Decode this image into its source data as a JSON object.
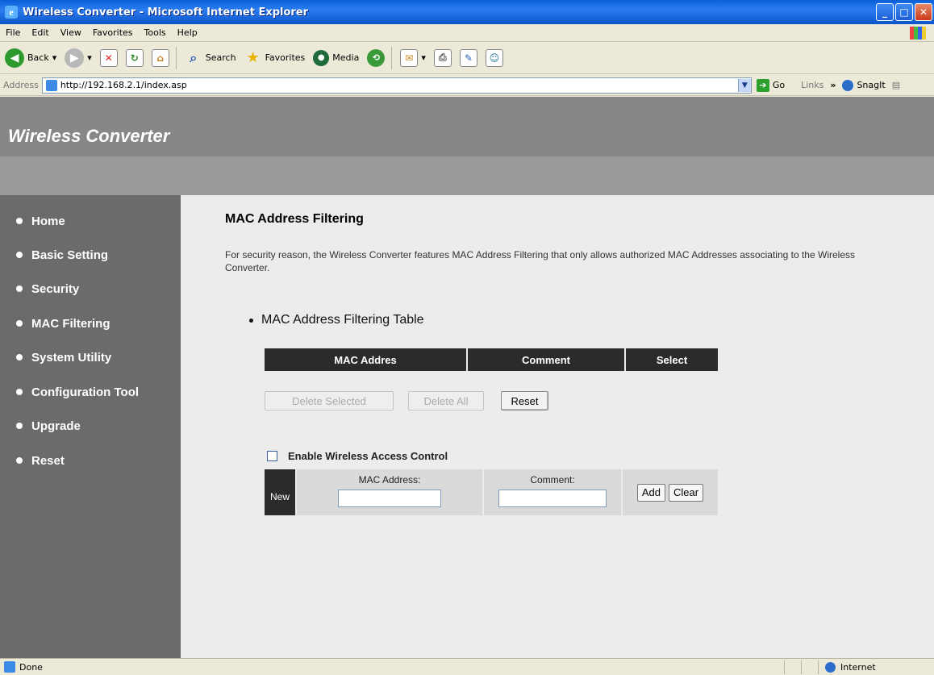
{
  "window": {
    "title": "Wireless Converter - Microsoft Internet Explorer"
  },
  "menu": [
    "File",
    "Edit",
    "View",
    "Favorites",
    "Tools",
    "Help"
  ],
  "toolbar": {
    "back": "Back",
    "search": "Search",
    "favorites": "Favorites",
    "media": "Media"
  },
  "address": {
    "label": "Address",
    "url": "http://192.168.2.1/index.asp",
    "go": "Go",
    "links": "Links",
    "snagit": "SnagIt"
  },
  "header": {
    "brand": "Wireless Converter"
  },
  "sidebar": {
    "items": [
      {
        "label": "Home"
      },
      {
        "label": "Basic Setting"
      },
      {
        "label": "Security"
      },
      {
        "label": "MAC Filtering"
      },
      {
        "label": "System Utility"
      },
      {
        "label": "Configuration Tool"
      },
      {
        "label": "Upgrade"
      },
      {
        "label": "Reset"
      }
    ]
  },
  "main": {
    "title": "MAC Address Filtering",
    "description": "For security reason, the Wireless Converter features MAC Address Filtering that only allows authorized MAC Addresses associating to the Wireless Converter.",
    "table_title": "MAC Address Filtering Table",
    "table_headers": [
      "MAC Addres",
      "Comment",
      "Select"
    ],
    "delete_selected": "Delete Selected",
    "delete_all": "Delete All",
    "reset": "Reset",
    "enable_label": "Enable Wireless Access Control",
    "new_label": "New",
    "mac_label": "MAC Address:",
    "comment_label": "Comment:",
    "mac_value": "",
    "comment_value": "",
    "add": "Add",
    "clear": "Clear"
  },
  "status": {
    "text": "Done",
    "zone": "Internet"
  }
}
